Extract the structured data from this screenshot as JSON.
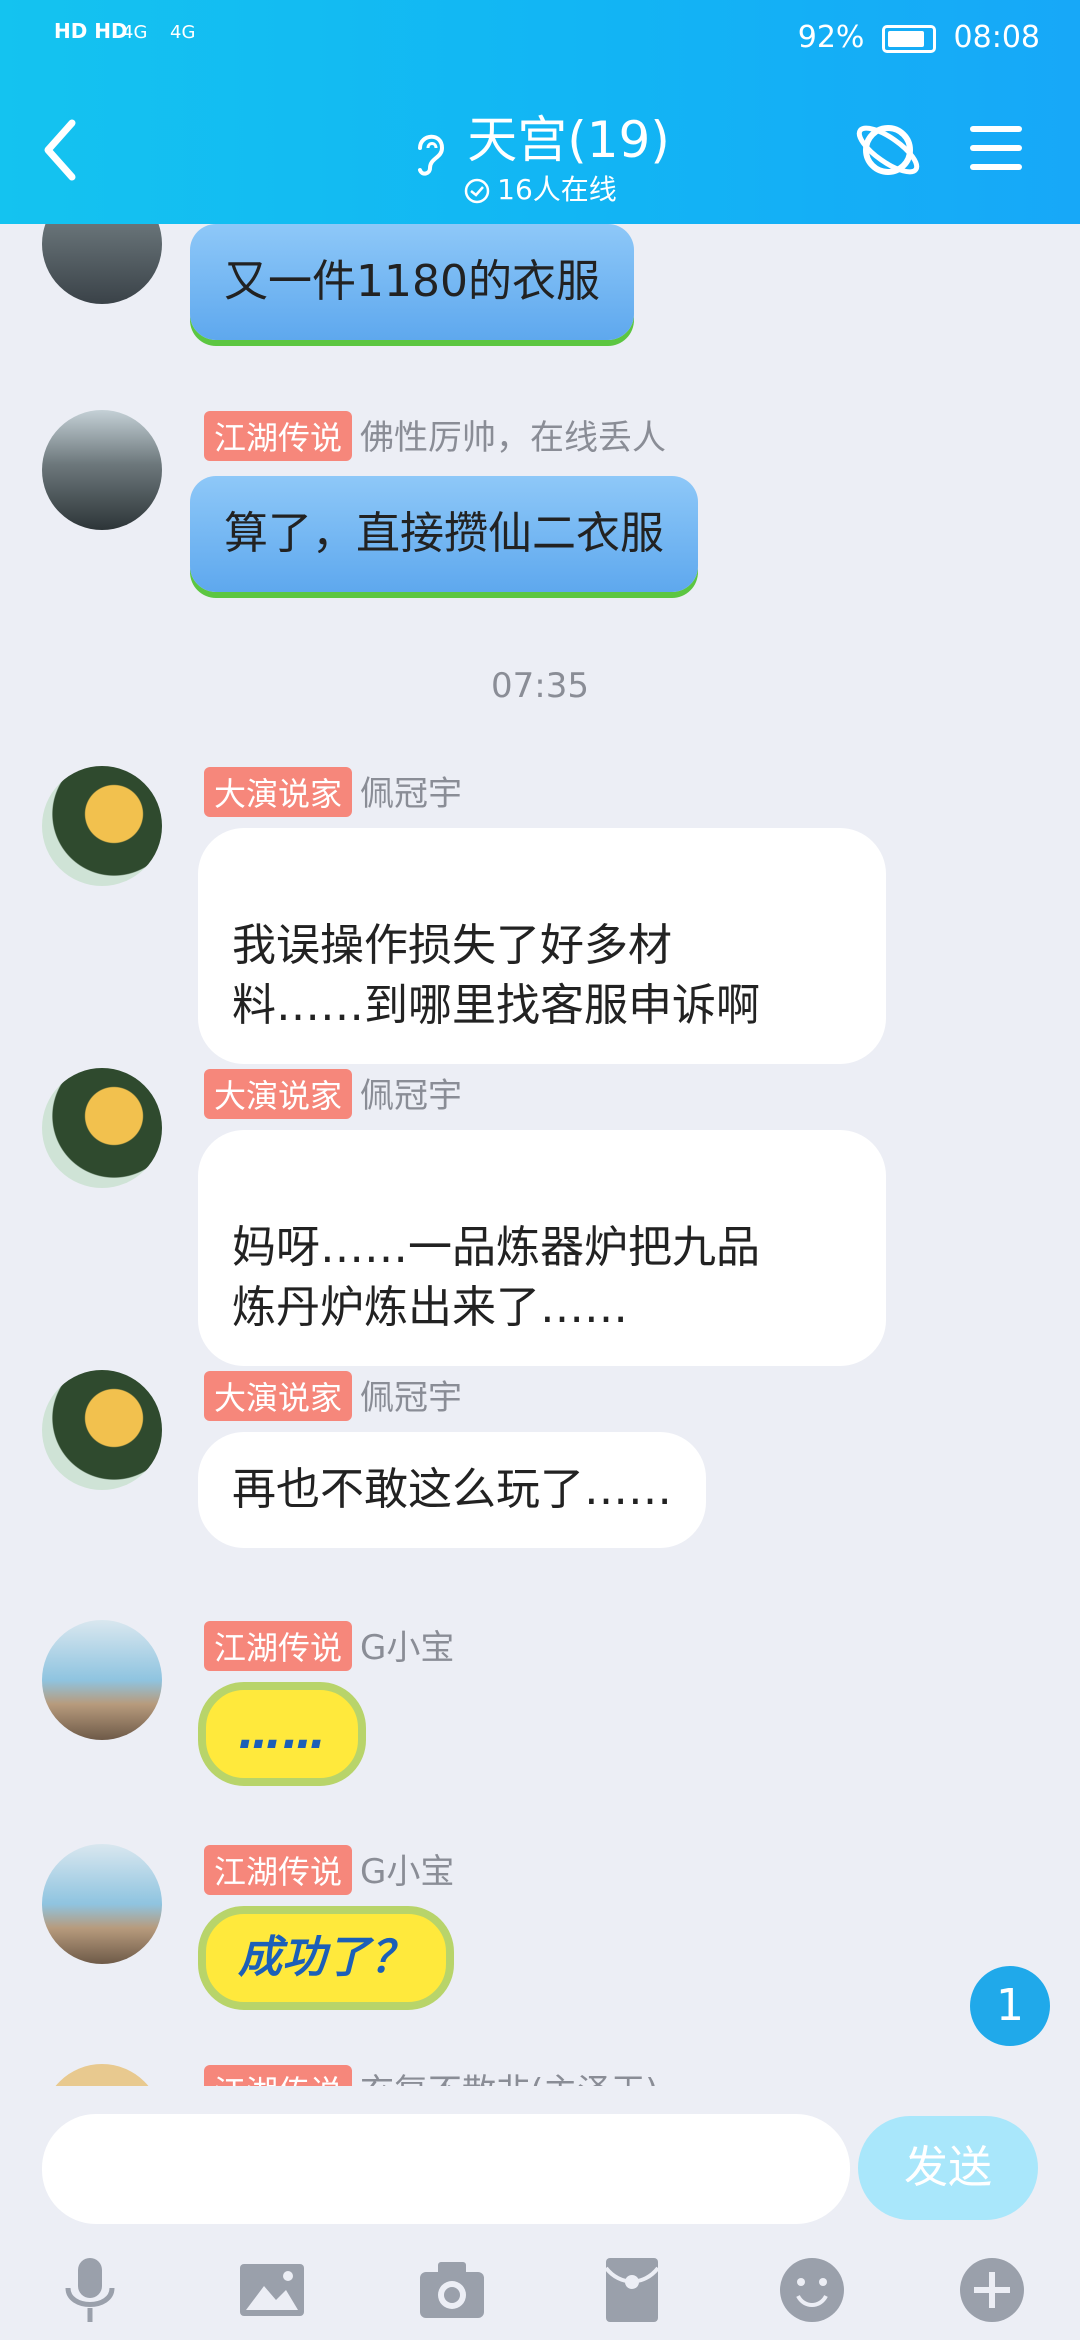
{
  "status_bar": {
    "left_labels": "HD HD",
    "net1": "4G",
    "net2": "4G",
    "battery_percent": "92%",
    "time": "08:08"
  },
  "header": {
    "title": "天宫(19)",
    "online_count": "16人在线"
  },
  "messages": [
    {
      "tag": "",
      "name": "",
      "text": "又一件1180的衣服",
      "style": "kite"
    },
    {
      "tag": "江湖传说",
      "name": "佛性厉帅，在线丢人",
      "text": "算了，直接攒仙二衣服",
      "style": "kite"
    },
    {
      "tag": "大演说家",
      "name": "佩冠宇",
      "text": "我误操作损失了好多材\n料……到哪里找客服申诉啊",
      "style": "white"
    },
    {
      "tag": "大演说家",
      "name": "佩冠宇",
      "text": "妈呀……一品炼器炉把九品\n炼丹炉炼出来了……",
      "style": "white"
    },
    {
      "tag": "大演说家",
      "name": "佩冠宇",
      "text": "再也不敢这么玩了……",
      "style": "white"
    },
    {
      "tag": "江湖传说",
      "name": "G小宝",
      "text": "……",
      "style": "lemon"
    },
    {
      "tag": "江湖传说",
      "name": "G小宝",
      "text": "成功了？",
      "style": "lemon"
    },
    {
      "tag": "江湖传说",
      "name": "玄复不散非(主泽王)",
      "text": "",
      "style": "partial"
    }
  ],
  "timestamp": "07:35",
  "unread_badge": "1",
  "input": {
    "placeholder": "",
    "send_label": "发送"
  },
  "toolbar": {
    "icons": [
      "microphone-icon",
      "image-icon",
      "camera-icon",
      "red-packet-icon",
      "emoji-icon",
      "plus-icon"
    ]
  },
  "colors": {
    "header_bg": "#14c3f0",
    "tag_bg": "#f6877b",
    "badge_bg": "#20a9ea",
    "send_bg": "#a9e7fb"
  }
}
